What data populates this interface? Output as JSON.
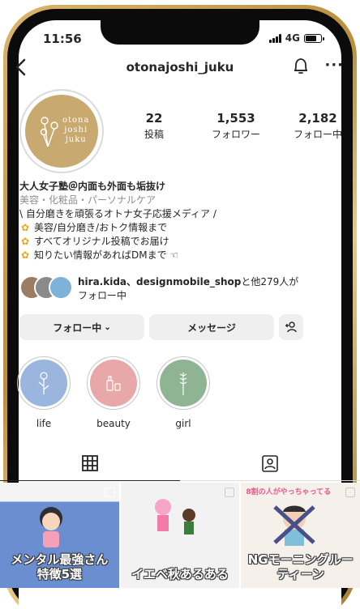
{
  "status_bar": {
    "time": "11:56",
    "network": "4G"
  },
  "header": {
    "username": "otonajoshi_juku"
  },
  "profile": {
    "avatar_text": [
      "otona",
      "joshi",
      "juku"
    ],
    "stats": [
      {
        "count": "22",
        "label": "投稿"
      },
      {
        "count": "1,553",
        "label": "フォロワー"
      },
      {
        "count": "2,182",
        "label": "フォロー中"
      }
    ],
    "name": "大人女子塾＠内面も外面も垢抜け",
    "category": "美容・化粧品・パーソナルケア",
    "bio_lines": [
      "\\ 自分磨きを頑張るオトナ女子応援メディア /",
      "美容/自分磨き/おトク情報まで",
      "すべてオリジナル投稿でお届け",
      "知りたい情報があればDMまで ☜"
    ],
    "followed_by": {
      "names": "hira.kida、designmobile_shop",
      "suffix": "と他279人が",
      "line2": "フォロー中"
    }
  },
  "actions": {
    "follow_label": "フォロー中",
    "message_label": "メッセージ"
  },
  "highlights": [
    {
      "label": "life",
      "color": "#9bb6de"
    },
    {
      "label": "beauty",
      "color": "#e8a7a8"
    },
    {
      "label": "girl",
      "color": "#8fb493"
    }
  ],
  "posts": [
    {
      "title": "メンタル最強さん特徴5選",
      "bg": "#6a8ed0"
    },
    {
      "title": "イエベ秋あるある",
      "bg": "#f2f2f2"
    },
    {
      "title": "NGモーニングルーティーン",
      "bg": "#f6f0ea",
      "tag": "8割の人がやっちゃってる"
    }
  ],
  "colors": {
    "gold": "#c8a970",
    "blue": "#6a8ed0",
    "text": "#262626",
    "muted": "#8e8e8e"
  }
}
